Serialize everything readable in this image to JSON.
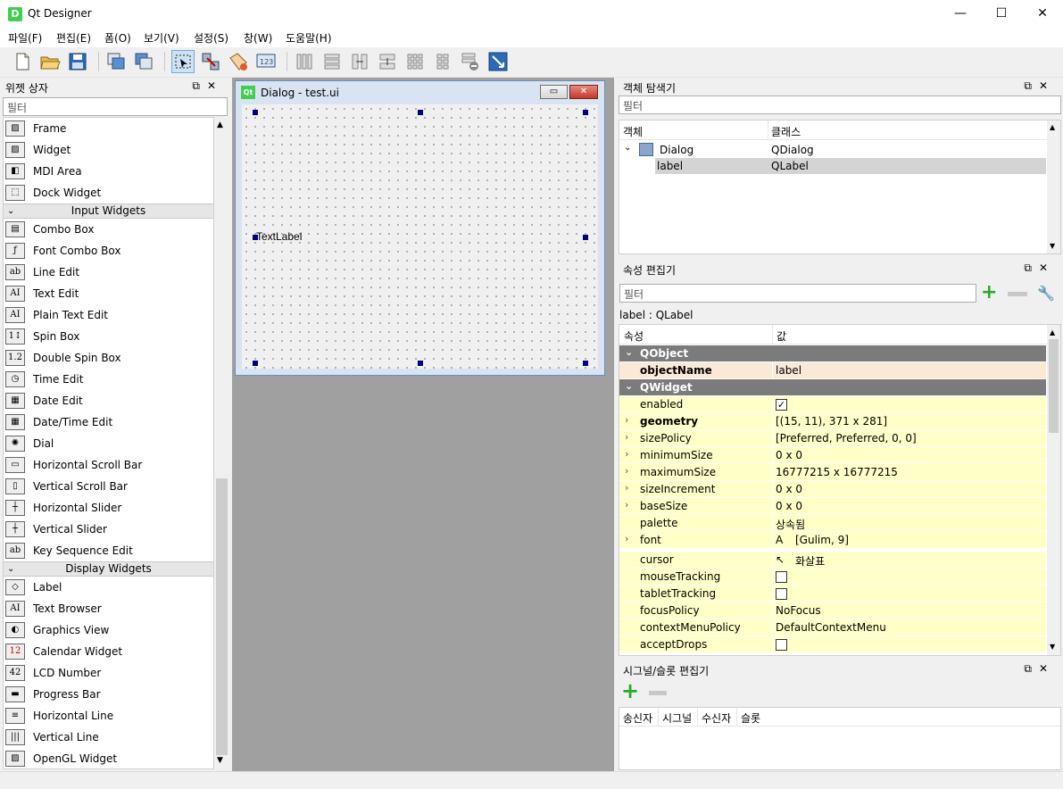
{
  "window": {
    "title": "Qt Designer",
    "app_icon": "D",
    "minimize": "—",
    "maximize": "☐",
    "close": "✕"
  },
  "menu": [
    "파일(F)",
    "편집(E)",
    "폼(O)",
    "보기(V)",
    "설정(S)",
    "창(W)",
    "도움말(H)"
  ],
  "widget_box": {
    "title": "위젯 상자",
    "filter_placeholder": "필터",
    "items_top": [
      "Frame",
      "Widget",
      "MDI Area",
      "Dock Widget"
    ],
    "cat_input": "Input Widgets",
    "input": [
      "Combo Box",
      "Font Combo Box",
      "Line Edit",
      "Text Edit",
      "Plain Text Edit",
      "Spin Box",
      "Double Spin Box",
      "Time Edit",
      "Date Edit",
      "Date/Time Edit",
      "Dial",
      "Horizontal Scroll Bar",
      "Vertical Scroll Bar",
      "Horizontal Slider",
      "Vertical Slider",
      "Key Sequence Edit"
    ],
    "cat_display": "Display Widgets",
    "display": [
      "Label",
      "Text Browser",
      "Graphics View",
      "Calendar Widget",
      "LCD Number",
      "Progress Bar",
      "Horizontal Line",
      "Vertical Line",
      "OpenGL Widget"
    ]
  },
  "dialog": {
    "icon": "Qt",
    "title": "Dialog - test.ui",
    "label_text": "TextLabel"
  },
  "object_inspector": {
    "title": "객체 탐색기",
    "filter_placeholder": "필터",
    "col_object": "객체",
    "col_class": "클래스",
    "rows": [
      {
        "name": "Dialog",
        "cls": "QDialog"
      },
      {
        "name": "label",
        "cls": "QLabel"
      }
    ]
  },
  "property_editor": {
    "title": "속성 편집기",
    "filter_placeholder": "필터",
    "object_line": "label : QLabel",
    "col_prop": "속성",
    "col_value": "값",
    "sec_qobject": "QObject",
    "sec_qwidget": "QWidget",
    "objectName": {
      "name": "objectName",
      "value": "label"
    },
    "props": [
      {
        "name": "enabled",
        "value": "",
        "check": true,
        "exp": false
      },
      {
        "name": "geometry",
        "value": "[(15, 11), 371 x 281]",
        "exp": true,
        "bold": true
      },
      {
        "name": "sizePolicy",
        "value": "[Preferred, Preferred, 0, 0]",
        "exp": true
      },
      {
        "name": "minimumSize",
        "value": "0 x 0",
        "exp": true
      },
      {
        "name": "maximumSize",
        "value": "16777215 x 16777215",
        "exp": true
      },
      {
        "name": "sizeIncrement",
        "value": "0 x 0",
        "exp": true
      },
      {
        "name": "baseSize",
        "value": "0 x 0",
        "exp": true
      },
      {
        "name": "palette",
        "value": "상속됨"
      },
      {
        "name": "font",
        "value": "[Gulim, 9]",
        "exp": true,
        "glyph": "A"
      },
      {
        "name": "cursor",
        "value": "화살표",
        "glyph": "↖"
      },
      {
        "name": "mouseTracking",
        "value": "",
        "check": false
      },
      {
        "name": "tabletTracking",
        "value": "",
        "check": false
      },
      {
        "name": "focusPolicy",
        "value": "NoFocus"
      },
      {
        "name": "contextMenuPolicy",
        "value": "DefaultContextMenu"
      },
      {
        "name": "acceptDrops",
        "value": "",
        "check": false
      }
    ]
  },
  "signal_slot": {
    "title": "시그널/슬롯 편집기",
    "cols": [
      "송신자",
      "시그널",
      "수신자",
      "슬롯"
    ]
  }
}
